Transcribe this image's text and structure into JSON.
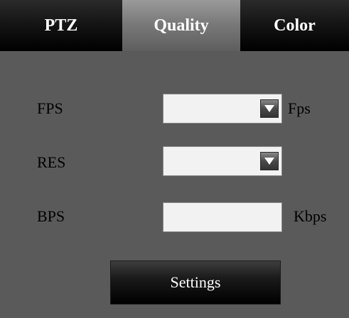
{
  "tabs": [
    {
      "label": "PTZ",
      "active": false
    },
    {
      "label": "Quality",
      "active": true
    },
    {
      "label": "Color",
      "active": false
    }
  ],
  "fields": {
    "fps": {
      "label": "FPS",
      "value": "",
      "unit": "Fps",
      "icon": "dropdown-arrow-icon"
    },
    "res": {
      "label": "RES",
      "value": "",
      "icon": "dropdown-arrow-icon"
    },
    "bps": {
      "label": "BPS",
      "value": "",
      "unit": "Kbps"
    }
  },
  "buttons": {
    "settings_label": "Settings"
  },
  "colors": {
    "panel_bg": "#5a5a5a",
    "active_tab": "#7a7a7a",
    "inactive_tab": "#000000",
    "text": "#000000"
  }
}
